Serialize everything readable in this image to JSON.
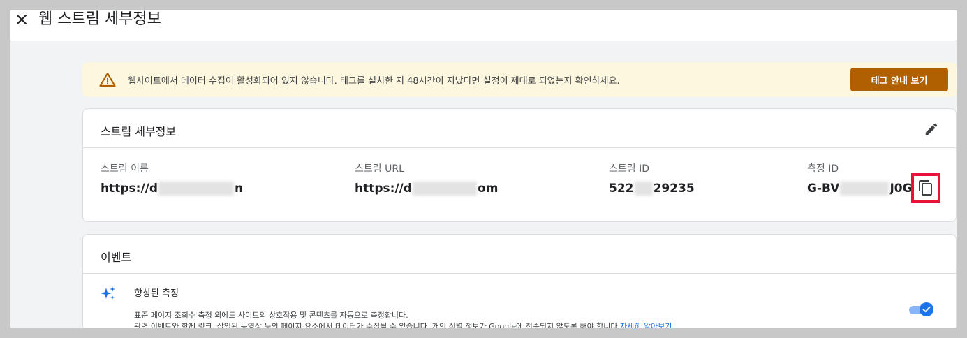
{
  "header": {
    "close_label": "✕",
    "title": "웹 스트림 세부정보"
  },
  "banner": {
    "text": "웹사이트에서 데이터 수집이 활성화되어 있지 않습니다. 태그를 설치한 지 48시간이 지났다면 설정이 제대로 되었는지 확인하세요.",
    "button_label": "태그 안내 보기",
    "button_color": "#b06000",
    "background": "#fef7e0"
  },
  "stream_details": {
    "title": "스트림 세부정보",
    "fields": [
      {
        "label": "스트림 이름",
        "value_start": "https://d",
        "value_end": "n"
      },
      {
        "label": "스트림 URL",
        "value_start": "https://d",
        "value_end": "om"
      },
      {
        "label": "스트림 ID",
        "value_start": "522",
        "value_end": "29235"
      },
      {
        "label": "측정 ID",
        "value_start": "G-BV",
        "value_end": "J0G"
      }
    ]
  },
  "events": {
    "title": "이벤트",
    "enhanced_title": "향상된 측정",
    "desc_line1": "표준 페이지 조회수 측정 외에도 사이트의 상호작용 및 콘텐츠를 자동으로 측정합니다.",
    "desc_line2": "관련 이벤트와 함께 링크, 삽입된 동영상 등의 페이지 요소에서 데이터가 수집될 수 있습니다. 개인 식별 정보가 Google에 전송되지 않도록 해야 합니다.",
    "learn_more": "자세히 알아보기",
    "toggle_on": true
  },
  "colors": {
    "accent": "#1a73e8",
    "highlight": "#e8133b"
  }
}
